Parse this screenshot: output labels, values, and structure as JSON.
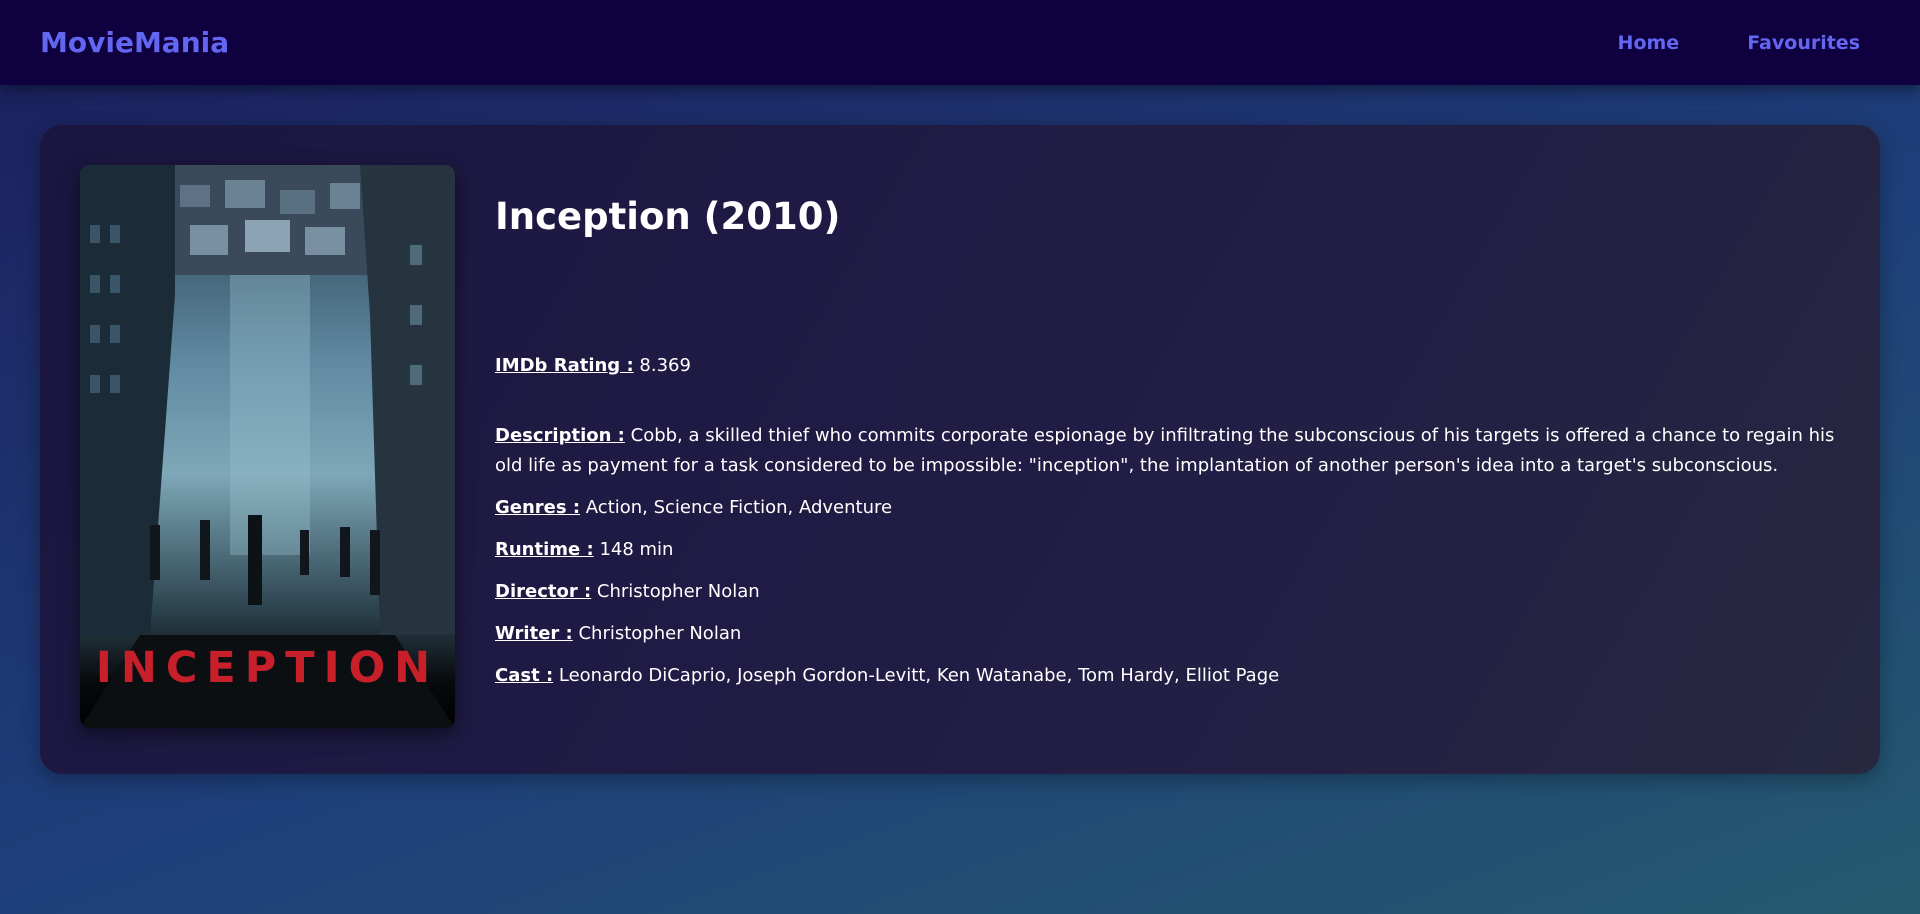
{
  "navbar": {
    "brand": "MovieMania",
    "links": [
      {
        "label": "Home"
      },
      {
        "label": "Favourites"
      }
    ]
  },
  "movie": {
    "title": "Inception (2010)",
    "poster_text": "INCEPTION",
    "rating_label": "IMDb Rating :",
    "rating_value": "8.369",
    "description_label": "Description :",
    "description_value": "Cobb, a skilled thief who commits corporate espionage by infiltrating the subconscious of his targets is offered a chance to regain his old life as payment for a task considered to be impossible: \"inception\", the implantation of another person's idea into a target's subconscious.",
    "genres_label": "Genres :",
    "genres_value": "Action, Science Fiction, Adventure",
    "runtime_label": "Runtime :",
    "runtime_value": "148 min",
    "director_label": "Director :",
    "director_value": "Christopher Nolan",
    "writer_label": "Writer :",
    "writer_value": "Christopher Nolan",
    "cast_label": "Cast :",
    "cast_value": "Leonardo DiCaprio, Joseph Gordon-Levitt, Ken Watanabe, Tom Hardy, Elliot Page"
  },
  "colors": {
    "brand": "#6366f1",
    "navbar_bg": "#0f0040",
    "poster_title": "#c8202a"
  }
}
